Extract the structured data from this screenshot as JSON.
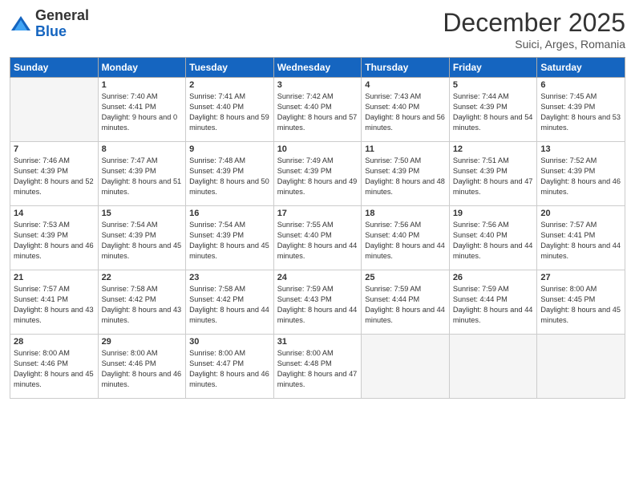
{
  "logo": {
    "general": "General",
    "blue": "Blue"
  },
  "header": {
    "month": "December 2025",
    "location": "Suici, Arges, Romania"
  },
  "weekdays": [
    "Sunday",
    "Monday",
    "Tuesday",
    "Wednesday",
    "Thursday",
    "Friday",
    "Saturday"
  ],
  "weeks": [
    [
      {
        "day": "",
        "empty": true
      },
      {
        "day": "1",
        "sunrise": "Sunrise: 7:40 AM",
        "sunset": "Sunset: 4:41 PM",
        "daylight": "Daylight: 9 hours and 0 minutes."
      },
      {
        "day": "2",
        "sunrise": "Sunrise: 7:41 AM",
        "sunset": "Sunset: 4:40 PM",
        "daylight": "Daylight: 8 hours and 59 minutes."
      },
      {
        "day": "3",
        "sunrise": "Sunrise: 7:42 AM",
        "sunset": "Sunset: 4:40 PM",
        "daylight": "Daylight: 8 hours and 57 minutes."
      },
      {
        "day": "4",
        "sunrise": "Sunrise: 7:43 AM",
        "sunset": "Sunset: 4:40 PM",
        "daylight": "Daylight: 8 hours and 56 minutes."
      },
      {
        "day": "5",
        "sunrise": "Sunrise: 7:44 AM",
        "sunset": "Sunset: 4:39 PM",
        "daylight": "Daylight: 8 hours and 54 minutes."
      },
      {
        "day": "6",
        "sunrise": "Sunrise: 7:45 AM",
        "sunset": "Sunset: 4:39 PM",
        "daylight": "Daylight: 8 hours and 53 minutes."
      }
    ],
    [
      {
        "day": "7",
        "sunrise": "Sunrise: 7:46 AM",
        "sunset": "Sunset: 4:39 PM",
        "daylight": "Daylight: 8 hours and 52 minutes."
      },
      {
        "day": "8",
        "sunrise": "Sunrise: 7:47 AM",
        "sunset": "Sunset: 4:39 PM",
        "daylight": "Daylight: 8 hours and 51 minutes."
      },
      {
        "day": "9",
        "sunrise": "Sunrise: 7:48 AM",
        "sunset": "Sunset: 4:39 PM",
        "daylight": "Daylight: 8 hours and 50 minutes."
      },
      {
        "day": "10",
        "sunrise": "Sunrise: 7:49 AM",
        "sunset": "Sunset: 4:39 PM",
        "daylight": "Daylight: 8 hours and 49 minutes."
      },
      {
        "day": "11",
        "sunrise": "Sunrise: 7:50 AM",
        "sunset": "Sunset: 4:39 PM",
        "daylight": "Daylight: 8 hours and 48 minutes."
      },
      {
        "day": "12",
        "sunrise": "Sunrise: 7:51 AM",
        "sunset": "Sunset: 4:39 PM",
        "daylight": "Daylight: 8 hours and 47 minutes."
      },
      {
        "day": "13",
        "sunrise": "Sunrise: 7:52 AM",
        "sunset": "Sunset: 4:39 PM",
        "daylight": "Daylight: 8 hours and 46 minutes."
      }
    ],
    [
      {
        "day": "14",
        "sunrise": "Sunrise: 7:53 AM",
        "sunset": "Sunset: 4:39 PM",
        "daylight": "Daylight: 8 hours and 46 minutes."
      },
      {
        "day": "15",
        "sunrise": "Sunrise: 7:54 AM",
        "sunset": "Sunset: 4:39 PM",
        "daylight": "Daylight: 8 hours and 45 minutes."
      },
      {
        "day": "16",
        "sunrise": "Sunrise: 7:54 AM",
        "sunset": "Sunset: 4:39 PM",
        "daylight": "Daylight: 8 hours and 45 minutes."
      },
      {
        "day": "17",
        "sunrise": "Sunrise: 7:55 AM",
        "sunset": "Sunset: 4:40 PM",
        "daylight": "Daylight: 8 hours and 44 minutes."
      },
      {
        "day": "18",
        "sunrise": "Sunrise: 7:56 AM",
        "sunset": "Sunset: 4:40 PM",
        "daylight": "Daylight: 8 hours and 44 minutes."
      },
      {
        "day": "19",
        "sunrise": "Sunrise: 7:56 AM",
        "sunset": "Sunset: 4:40 PM",
        "daylight": "Daylight: 8 hours and 44 minutes."
      },
      {
        "day": "20",
        "sunrise": "Sunrise: 7:57 AM",
        "sunset": "Sunset: 4:41 PM",
        "daylight": "Daylight: 8 hours and 44 minutes."
      }
    ],
    [
      {
        "day": "21",
        "sunrise": "Sunrise: 7:57 AM",
        "sunset": "Sunset: 4:41 PM",
        "daylight": "Daylight: 8 hours and 43 minutes."
      },
      {
        "day": "22",
        "sunrise": "Sunrise: 7:58 AM",
        "sunset": "Sunset: 4:42 PM",
        "daylight": "Daylight: 8 hours and 43 minutes."
      },
      {
        "day": "23",
        "sunrise": "Sunrise: 7:58 AM",
        "sunset": "Sunset: 4:42 PM",
        "daylight": "Daylight: 8 hours and 44 minutes."
      },
      {
        "day": "24",
        "sunrise": "Sunrise: 7:59 AM",
        "sunset": "Sunset: 4:43 PM",
        "daylight": "Daylight: 8 hours and 44 minutes."
      },
      {
        "day": "25",
        "sunrise": "Sunrise: 7:59 AM",
        "sunset": "Sunset: 4:44 PM",
        "daylight": "Daylight: 8 hours and 44 minutes."
      },
      {
        "day": "26",
        "sunrise": "Sunrise: 7:59 AM",
        "sunset": "Sunset: 4:44 PM",
        "daylight": "Daylight: 8 hours and 44 minutes."
      },
      {
        "day": "27",
        "sunrise": "Sunrise: 8:00 AM",
        "sunset": "Sunset: 4:45 PM",
        "daylight": "Daylight: 8 hours and 45 minutes."
      }
    ],
    [
      {
        "day": "28",
        "sunrise": "Sunrise: 8:00 AM",
        "sunset": "Sunset: 4:46 PM",
        "daylight": "Daylight: 8 hours and 45 minutes."
      },
      {
        "day": "29",
        "sunrise": "Sunrise: 8:00 AM",
        "sunset": "Sunset: 4:46 PM",
        "daylight": "Daylight: 8 hours and 46 minutes."
      },
      {
        "day": "30",
        "sunrise": "Sunrise: 8:00 AM",
        "sunset": "Sunset: 4:47 PM",
        "daylight": "Daylight: 8 hours and 46 minutes."
      },
      {
        "day": "31",
        "sunrise": "Sunrise: 8:00 AM",
        "sunset": "Sunset: 4:48 PM",
        "daylight": "Daylight: 8 hours and 47 minutes."
      },
      {
        "day": "",
        "empty": true
      },
      {
        "day": "",
        "empty": true
      },
      {
        "day": "",
        "empty": true
      }
    ]
  ]
}
